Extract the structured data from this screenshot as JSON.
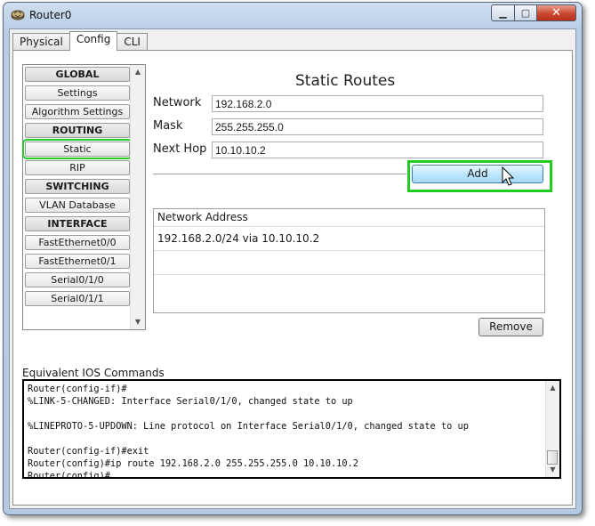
{
  "window": {
    "title": "Router0",
    "minimize_icon": "minimize-icon",
    "maximize_icon": "maximize-icon",
    "close_icon": "close-icon"
  },
  "tabs": [
    {
      "label": "Physical",
      "active": false
    },
    {
      "label": "Config",
      "active": true
    },
    {
      "label": "CLI",
      "active": false
    }
  ],
  "nav": {
    "items": [
      {
        "label": "GLOBAL",
        "header": true
      },
      {
        "label": "Settings"
      },
      {
        "label": "Algorithm Settings"
      },
      {
        "label": "ROUTING",
        "header": true
      },
      {
        "label": "Static",
        "selected": true
      },
      {
        "label": "RIP"
      },
      {
        "label": "SWITCHING",
        "header": true
      },
      {
        "label": "VLAN Database"
      },
      {
        "label": "INTERFACE",
        "header": true
      },
      {
        "label": "FastEthernet0/0"
      },
      {
        "label": "FastEthernet0/1"
      },
      {
        "label": "Serial0/1/0"
      },
      {
        "label": "Serial0/1/1"
      }
    ]
  },
  "static_routes": {
    "title": "Static Routes",
    "network_label": "Network",
    "network_value": "192.168.2.0",
    "mask_label": "Mask",
    "mask_value": "255.255.255.0",
    "next_hop_label": "Next Hop",
    "next_hop_value": "10.10.10.2",
    "add_label": "Add",
    "table_header": "Network Address",
    "routes": [
      "192.168.2.0/24 via 10.10.10.2"
    ],
    "remove_label": "Remove"
  },
  "ios": {
    "label": "Equivalent IOS Commands",
    "lines": [
      "Router(config-if)#",
      "%LINK-5-CHANGED: Interface Serial0/1/0, changed state to up",
      "",
      "%LINEPROTO-5-UPDOWN: Line protocol on Interface Serial0/1/0, changed state to up",
      "",
      "Router(config-if)#exit",
      "Router(config)#ip route 192.168.2.0 255.255.255.0 10.10.10.2",
      "Router(config)#"
    ]
  },
  "colors": {
    "highlight": "#22cc22",
    "add_button": "#bee6fd",
    "window_frame": "#b9cee6"
  }
}
